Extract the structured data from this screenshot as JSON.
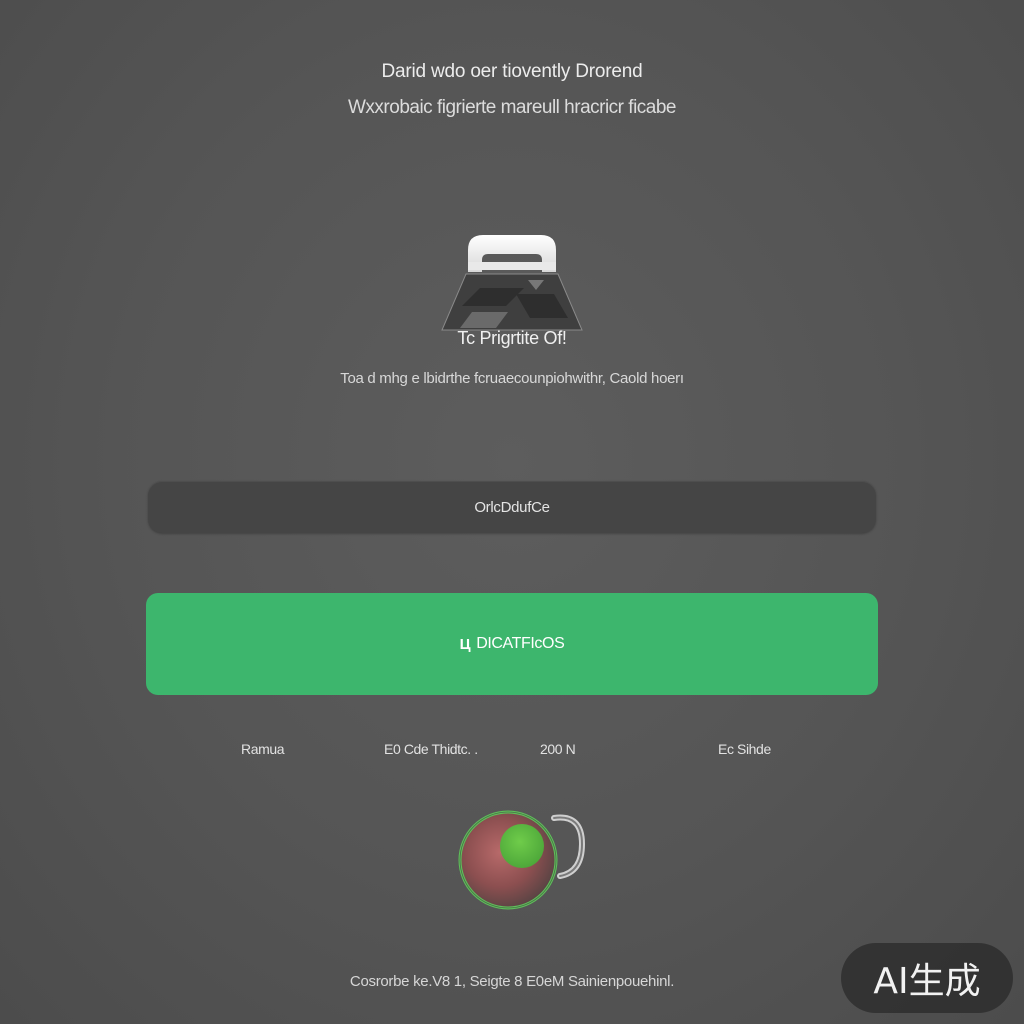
{
  "header": {
    "title": "Darid wdo oer tiovently Drorend",
    "subtitle": "Wxxrobaic figrierte mareull hracricr ficabe"
  },
  "product": {
    "name": "Tc Prigrtite Of!",
    "description": "Toa d mhg e lbidrthe fcruaecounpiohwithr, Caold hoerı"
  },
  "buttons": {
    "secondary_label": "OrlcDdufCe",
    "primary_label": "DICATFIcOS",
    "primary_icon": "Ц"
  },
  "stats": {
    "item1": "Ramua",
    "item2": "E0 Cde Thidtc. .",
    "item3": "200 N",
    "item4": "Ec Sihde"
  },
  "footer": {
    "text": "Cosrorbe ke.V8 1, Seigte 8 E0eM Sainienpouehinl."
  },
  "watermark": {
    "text": "AI生成"
  },
  "colors": {
    "background": "#555555",
    "accent": "#3db66d",
    "secondary_button": "#454545"
  },
  "icons": {
    "logo": "bag-logo-icon",
    "avatar": "avatar-orb-icon"
  }
}
